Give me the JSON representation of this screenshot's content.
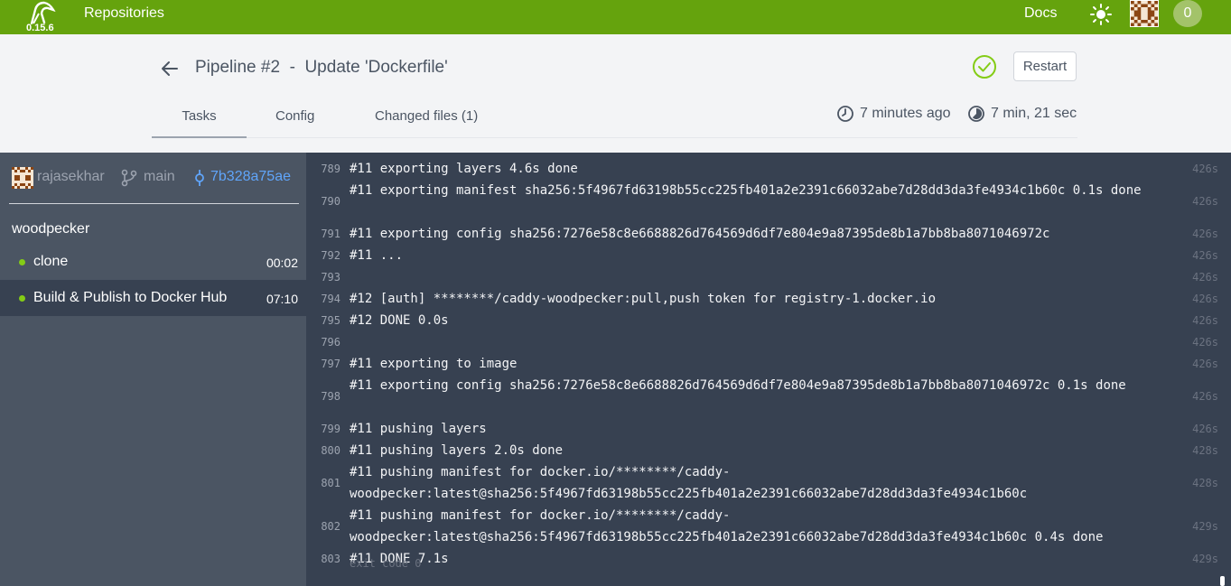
{
  "navbar": {
    "version": "0.15.6",
    "repositories": "Repositories",
    "docs": "Docs",
    "notifications": "0",
    "logo_icon": "woodpecker-logo-icon",
    "theme_icon": "sun-icon"
  },
  "header": {
    "title": "Pipeline #2  -  Update 'Dockerfile'",
    "restart": "Restart",
    "tabs": [
      "Tasks",
      "Config",
      "Changed files (1)"
    ],
    "created": "7 minutes ago",
    "duration": "7 min, 21 sec",
    "status_color": "#84cc16"
  },
  "sidebar": {
    "author": "rajasekhar",
    "branch": "main",
    "commit": "7b328a75ae",
    "workflow": "woodpecker",
    "steps": [
      {
        "name": "clone",
        "time": "00:02"
      },
      {
        "name": "Build & Publish to Docker Hub",
        "time": "07:10"
      }
    ]
  },
  "log": {
    "lines": [
      {
        "n": "789",
        "text": "#11 exporting layers 4.6s done",
        "t": "426s"
      },
      {
        "n": "790",
        "text": "#11 exporting manifest sha256:5f4967fd63198b55cc225fb401a2e2391c66032abe7d28dd3da3fe4934c1b60c 0.1s done",
        "t": "426s"
      },
      {
        "n": "791",
        "text": "#11 exporting config sha256:7276e58c8e6688826d764569d6df7e804e9a87395de8b1a7bb8ba8071046972c",
        "t": "426s"
      },
      {
        "n": "792",
        "text": "#11 ...",
        "t": "426s"
      },
      {
        "n": "793",
        "text": "",
        "t": "426s"
      },
      {
        "n": "794",
        "text": "#12 [auth] ********/caddy-woodpecker:pull,push token for registry-1.docker.io",
        "t": "426s"
      },
      {
        "n": "795",
        "text": "#12 DONE 0.0s",
        "t": "426s"
      },
      {
        "n": "796",
        "text": "",
        "t": "426s"
      },
      {
        "n": "797",
        "text": "#11 exporting to image",
        "t": "426s"
      },
      {
        "n": "798",
        "text": "#11 exporting config sha256:7276e58c8e6688826d764569d6df7e804e9a87395de8b1a7bb8ba8071046972c 0.1s done",
        "t": "426s"
      },
      {
        "n": "799",
        "text": "#11 pushing layers",
        "t": "426s"
      },
      {
        "n": "800",
        "text": "#11 pushing layers 2.0s done",
        "t": "428s"
      },
      {
        "n": "801",
        "text": "#11 pushing manifest for docker.io/********/caddy-\nwoodpecker:latest@sha256:5f4967fd63198b55cc225fb401a2e2391c66032abe7d28dd3da3fe4934c1b60c",
        "t": "428s"
      },
      {
        "n": "802",
        "text": "#11 pushing manifest for docker.io/********/caddy-\nwoodpecker:latest@sha256:5f4967fd63198b55cc225fb401a2e2391c66032abe7d28dd3da3fe4934c1b60c 0.4s done",
        "t": "429s"
      },
      {
        "n": "803",
        "text": "#11 DONE 7.1s",
        "t": "429s"
      }
    ],
    "exit": "exit code 0"
  }
}
